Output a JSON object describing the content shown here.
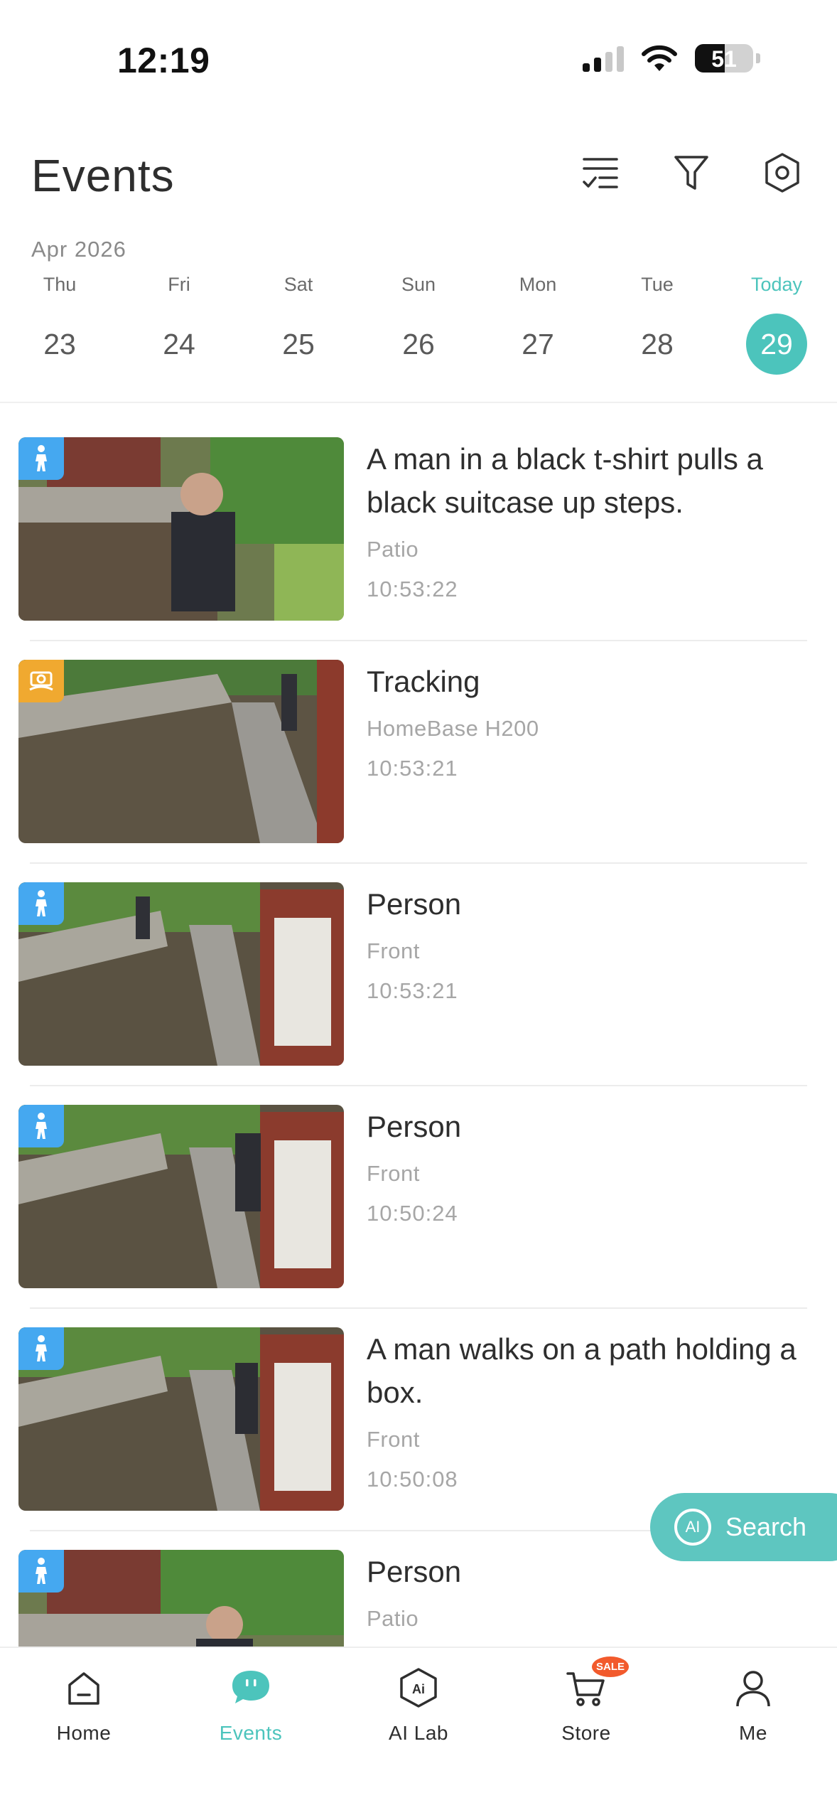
{
  "status_bar": {
    "time": "12:19",
    "battery": "51"
  },
  "header": {
    "title": "Events",
    "icons": [
      "checklist-icon",
      "filter-icon",
      "settings-icon"
    ]
  },
  "calendar": {
    "month": "Apr 2026",
    "days": [
      {
        "name": "Thu",
        "num": "23"
      },
      {
        "name": "Fri",
        "num": "24"
      },
      {
        "name": "Sat",
        "num": "25"
      },
      {
        "name": "Sun",
        "num": "26"
      },
      {
        "name": "Mon",
        "num": "27"
      },
      {
        "name": "Tue",
        "num": "28"
      },
      {
        "name": "Today",
        "num": "29"
      }
    ]
  },
  "events": [
    {
      "title": "A man in a black t-shirt pulls a black suitcase up steps.",
      "source": "Patio",
      "time": "10:53:22",
      "badge": "person"
    },
    {
      "title": "Tracking",
      "source": "HomeBase H200",
      "time": "10:53:21",
      "badge": "tracking"
    },
    {
      "title": "Person",
      "source": "Front",
      "time": "10:53:21",
      "badge": "person"
    },
    {
      "title": "Person",
      "source": "Front",
      "time": "10:50:24",
      "badge": "person"
    },
    {
      "title": "A man walks on a path holding a box.",
      "source": "Front",
      "time": "10:50:08",
      "badge": "person"
    },
    {
      "title": "Person",
      "source": "Patio",
      "time": "",
      "badge": "person"
    }
  ],
  "search": {
    "label": "Search",
    "icon_text": "AI"
  },
  "bottom_nav": {
    "items": [
      {
        "label": "Home"
      },
      {
        "label": "Events"
      },
      {
        "label": "AI Lab"
      },
      {
        "label": "Store",
        "badge": "SALE"
      },
      {
        "label": "Me"
      }
    ]
  },
  "colors": {
    "accent": "#4cc4bc",
    "person_badge": "#45a8f0",
    "tracking_badge": "#f0a930",
    "sale": "#f25a2c"
  }
}
